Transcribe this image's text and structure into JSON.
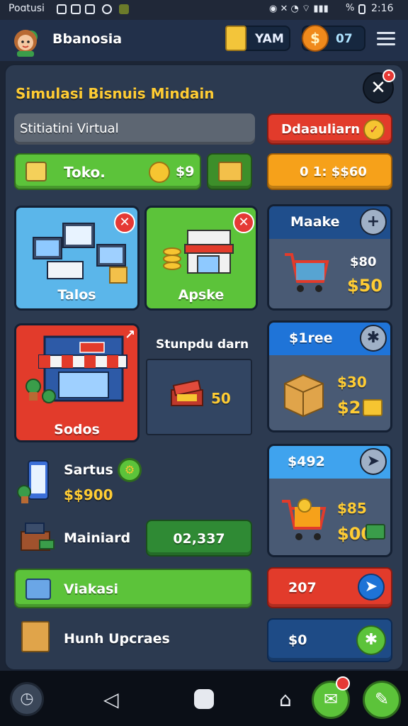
{
  "status_bar": {
    "carrier": "Poɑtusi",
    "time": "2:16",
    "battery": "%"
  },
  "top_bar": {
    "player_name": "Bbanosia",
    "gold_value": "YAM",
    "coin_value": "07"
  },
  "panel": {
    "title": "Simulasi Bisnuis Mindain",
    "subtitle": "Stitiatini Virtual",
    "toko_button": {
      "label": "Toko.",
      "value": "$9"
    },
    "right_header_red": "Ddaauliarn",
    "right_header_orange": "0 1: $$60",
    "cards": {
      "talos": "Talos",
      "apske": "Apske",
      "sodos": "Sodos"
    },
    "stat_box": {
      "title": "Stunpdu darn",
      "value": "50"
    },
    "sartus": {
      "label": "Sartus",
      "value": "$$900"
    },
    "mainiard": {
      "label": "Mainiard",
      "value": "02,337"
    },
    "viakasi": "Viakasi",
    "hunh": "Hunh Upcraes"
  },
  "side_cards": [
    {
      "header": "Maake",
      "price_top": "$80",
      "price_main": "$50",
      "header_color": "#1f4e8c"
    },
    {
      "header": "$1ree",
      "price_top": "$30",
      "price_main": "$2",
      "header_color": "#1f74d8"
    },
    {
      "header": "$492",
      "price_top": "$85",
      "price_main": "$00",
      "header_color": "#3fa3ee"
    }
  ],
  "side_bottom": {
    "red_label": "207",
    "blue_label": "$0"
  },
  "colors": {
    "green": "#5cc33a",
    "red": "#e23b2b",
    "orange": "#f6a11a",
    "blue": "#1e73d6",
    "gold_text": "#ffcc33"
  }
}
